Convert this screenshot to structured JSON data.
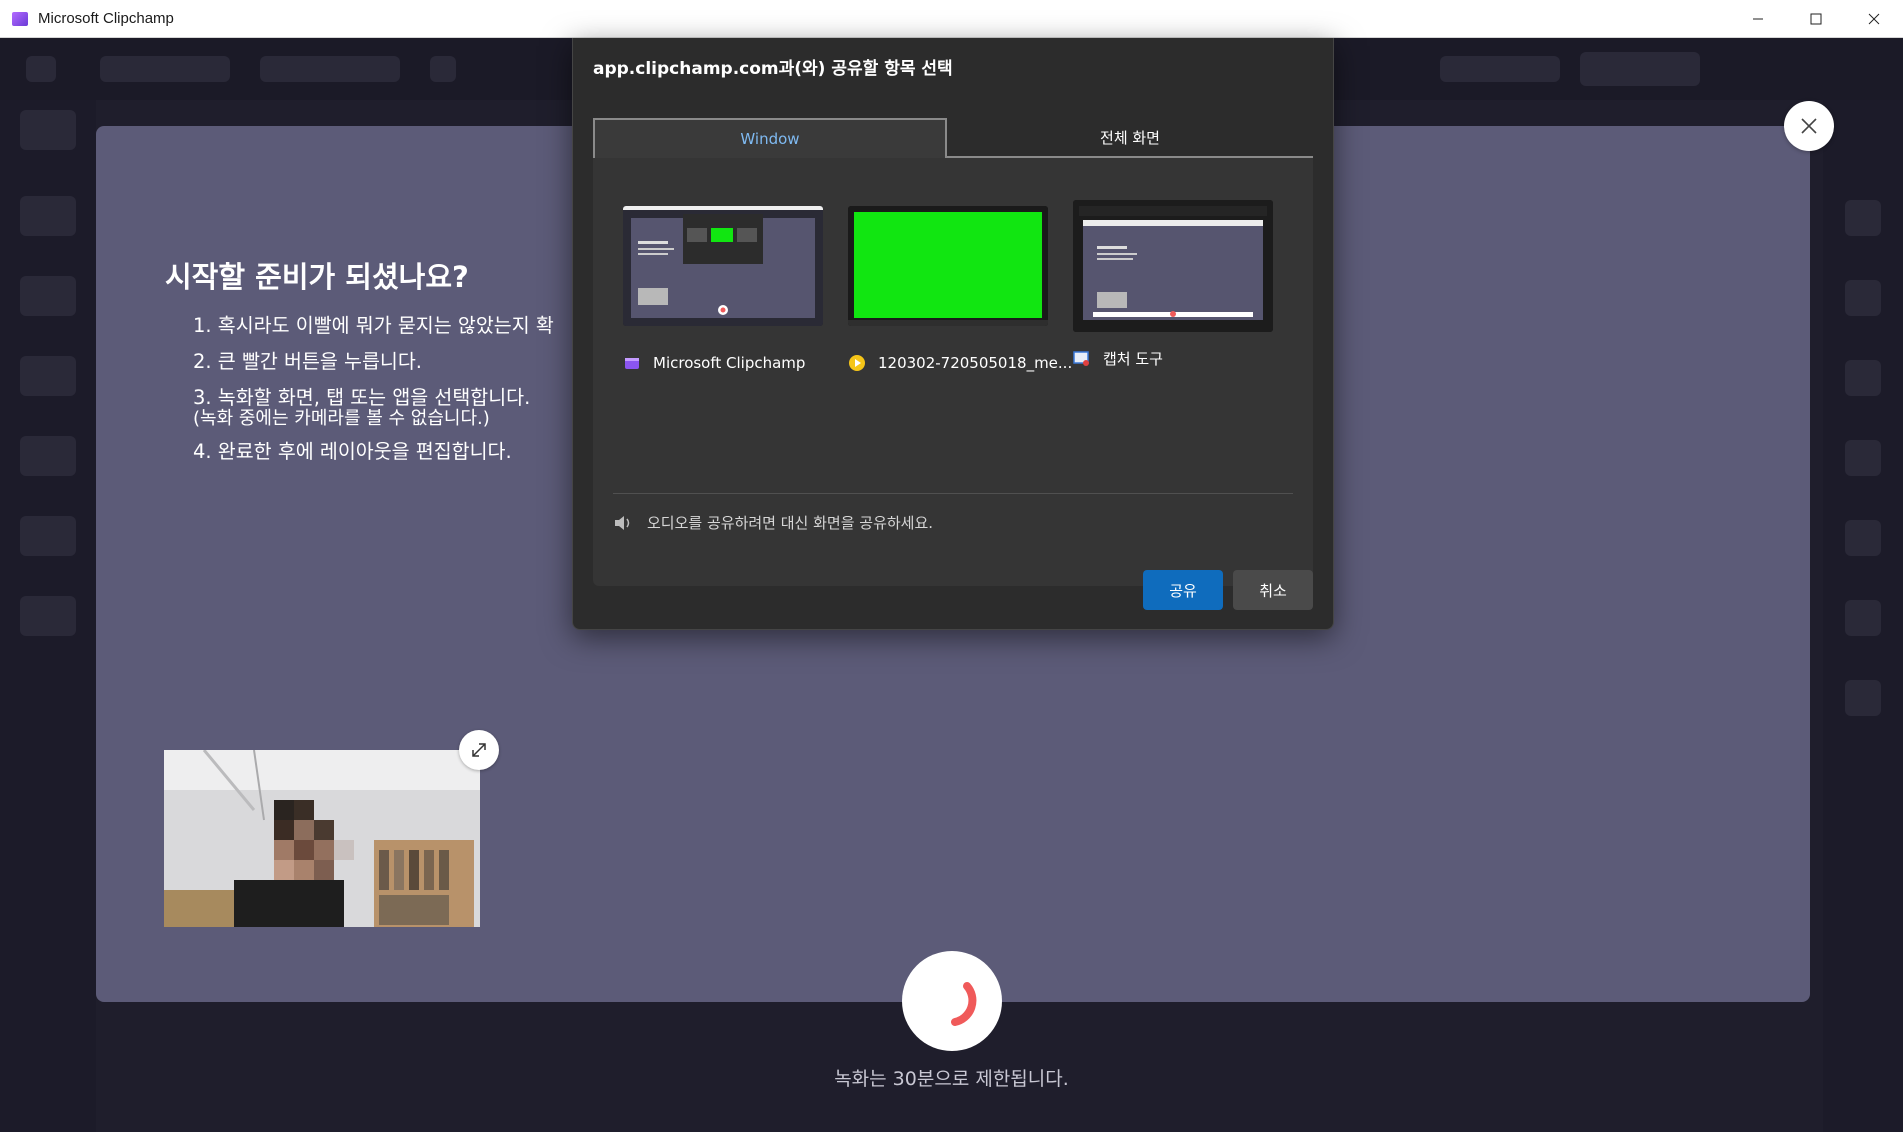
{
  "window": {
    "title": "Microsoft Clipchamp",
    "minimize_icon": "minimize-icon",
    "maximize_icon": "maximize-icon",
    "close_icon": "close-icon"
  },
  "share_dialog": {
    "title": "app.clipchamp.com과(와) 공유할 항목 선택",
    "tabs": [
      {
        "label": "Window",
        "selected": true
      },
      {
        "label": "전체 화면",
        "selected": false
      }
    ],
    "sources": [
      {
        "label": "Microsoft Clipchamp",
        "icon": "clipchamp-icon"
      },
      {
        "label": "120302-720505018_me...",
        "icon": "media-player-icon"
      },
      {
        "label": "캡처 도구",
        "icon": "snipping-tool-icon"
      }
    ],
    "audio_note": "오디오를 공유하려면 대신 화면을 공유하세요.",
    "share_button": "공유",
    "cancel_button": "취소"
  },
  "recorder": {
    "heading": "시작할 준비가 되셨나요?",
    "steps": [
      "1. 혹시라도 이빨에 뭐가 묻지는 않았는지 확",
      "2. 큰 빨간 버튼을 누릅니다.",
      "3. 녹화할 화면, 탭 또는 앱을 선택합니다.",
      "(녹화 중에는 카메라를 볼 수 없습니다.)",
      "4. 완료한 후에 레이아웃을 편집합니다."
    ],
    "limit_text": "녹화는 30분으로 제한됩니다."
  },
  "colors": {
    "accent": "#0f6cbd",
    "record": "#f05a5a",
    "panel": "#5c5b78",
    "selected_tab_text": "#7fbaf2"
  }
}
